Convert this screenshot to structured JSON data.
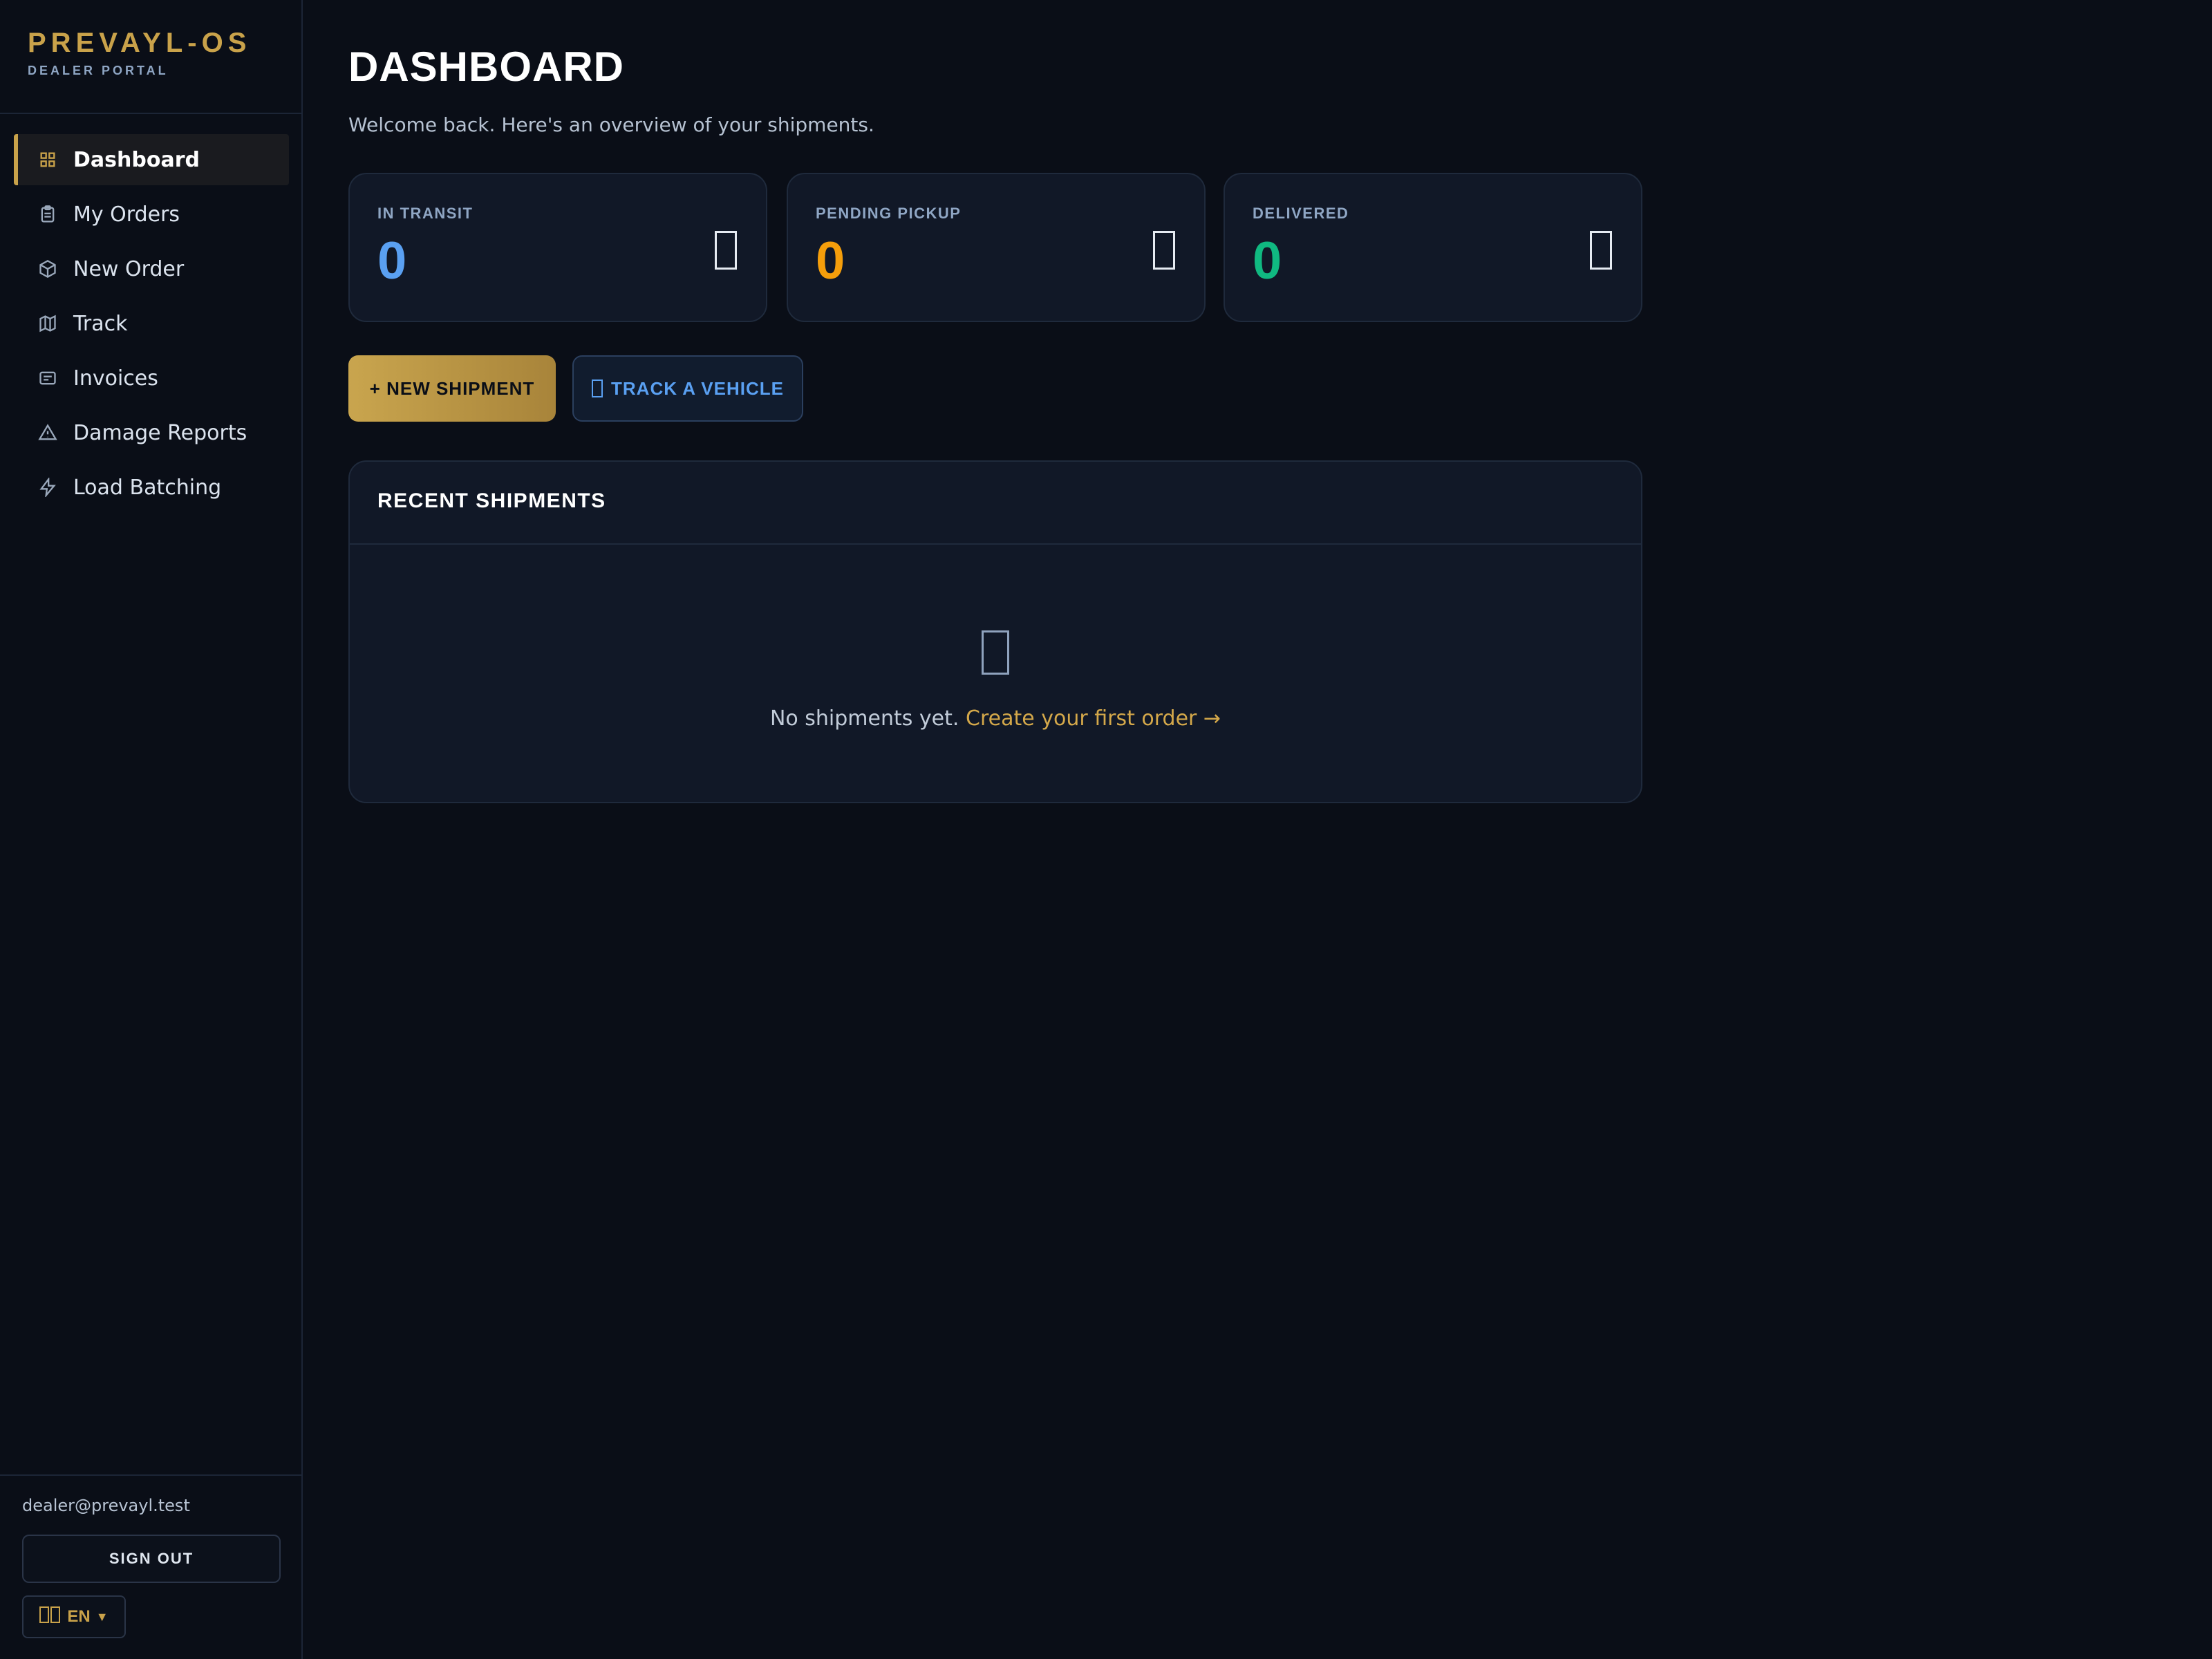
{
  "brand": {
    "title": "PREVAYL-OS",
    "subtitle": "DEALER PORTAL"
  },
  "nav": [
    {
      "label": "Dashboard",
      "icon": "grid-icon",
      "active": true
    },
    {
      "label": "My Orders",
      "icon": "clipboard-icon"
    },
    {
      "label": "New Order",
      "icon": "box-icon"
    },
    {
      "label": "Track",
      "icon": "map-icon"
    },
    {
      "label": "Invoices",
      "icon": "receipt-icon"
    },
    {
      "label": "Damage Reports",
      "icon": "warning-triangle-icon"
    },
    {
      "label": "Load Batching",
      "icon": "lightning-icon"
    }
  ],
  "user": {
    "email": "dealer@prevayl.test",
    "signout_label": "SIGN OUT",
    "language": "EN"
  },
  "page": {
    "title": "DASHBOARD",
    "subtitle": "Welcome back. Here's an overview of your shipments."
  },
  "stats": [
    {
      "label": "IN TRANSIT",
      "value": "0",
      "color": "#5aa0f2"
    },
    {
      "label": "PENDING PICKUP",
      "value": "0",
      "color": "#f59e0b"
    },
    {
      "label": "DELIVERED",
      "value": "0",
      "color": "#10b981"
    }
  ],
  "actions": {
    "new_shipment": "+ NEW SHIPMENT",
    "track_vehicle": "TRACK A VEHICLE"
  },
  "recent": {
    "title": "RECENT SHIPMENTS",
    "empty_text": "No shipments yet.",
    "empty_link": "Create your first order →"
  },
  "colors": {
    "accent": "#c9a24a",
    "background": "#0a0e17",
    "card": "#111827"
  }
}
